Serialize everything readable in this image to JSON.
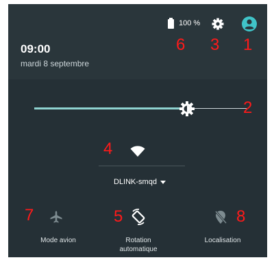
{
  "status": {
    "time": "09:00",
    "date": "mardi 8 septembre",
    "battery_pct": "100 %"
  },
  "brightness": {
    "level": 0.72
  },
  "wifi": {
    "network": "DLINK-smqd"
  },
  "tiles": {
    "airplane": {
      "label": "Mode avion",
      "state": "off"
    },
    "rotation": {
      "label_line1": "Rotation",
      "label_line2": "automatique",
      "state": "on"
    },
    "location": {
      "label": "Localisation",
      "state": "off"
    }
  },
  "callouts": {
    "n1": "1",
    "n2": "2",
    "n3": "3",
    "n4": "4",
    "n5": "5",
    "n6": "6",
    "n7": "7",
    "n8": "8"
  },
  "colors": {
    "panel": "#253036",
    "header": "#2a363b",
    "accent": "#40c4c8",
    "callout": "#ff1a1a"
  },
  "icons": [
    "battery-icon",
    "gear-icon",
    "account-icon",
    "brightness-icon",
    "wifi-icon",
    "airplane-icon",
    "rotation-icon",
    "location-off-icon"
  ]
}
